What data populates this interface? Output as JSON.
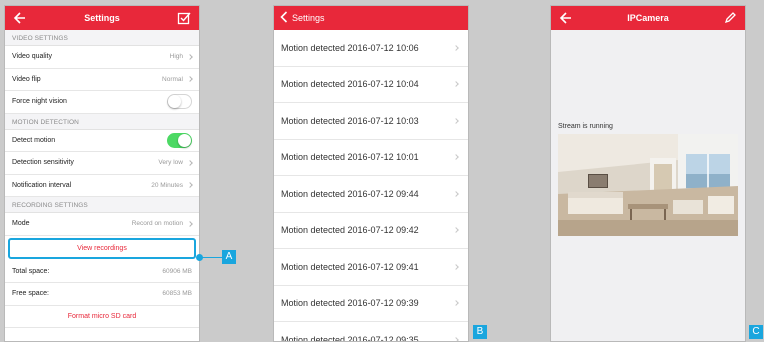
{
  "settings": {
    "title": "Settings",
    "sections": [
      {
        "header": "VIDEO SETTINGS",
        "rows": [
          {
            "label": "Video quality",
            "value": "High",
            "kind": "chevron"
          },
          {
            "label": "Video flip",
            "value": "Normal",
            "kind": "chevron"
          },
          {
            "label": "Force night vision",
            "kind": "toggle",
            "on": false
          }
        ]
      },
      {
        "header": "MOTION DETECTION",
        "rows": [
          {
            "label": "Detect motion",
            "kind": "toggle",
            "on": true
          },
          {
            "label": "Detection sensitivity",
            "value": "Very low",
            "kind": "chevron"
          },
          {
            "label": "Notification interval",
            "value": "20 Minutes",
            "kind": "chevron"
          }
        ]
      },
      {
        "header": "RECORDING SETTINGS",
        "rows": [
          {
            "label": "Mode",
            "value": "Record on motion",
            "kind": "chevron"
          }
        ]
      }
    ],
    "view_recordings": "View recordings",
    "total_space_label": "Total space:",
    "total_space_value": "60906 MB",
    "free_space_label": "Free space:",
    "free_space_value": "60853 MB",
    "format_label": "Format micro SD card"
  },
  "recordings": {
    "back_label": "Settings",
    "items": [
      "Motion detected 2016-07-12 10:06",
      "Motion detected 2016-07-12 10:04",
      "Motion detected 2016-07-12 10:03",
      "Motion detected 2016-07-12 10:01",
      "Motion detected 2016-07-12 09:44",
      "Motion detected 2016-07-12 09:42",
      "Motion detected 2016-07-12 09:41",
      "Motion detected 2016-07-12 09:39",
      "Motion detected 2016-07-12 09:35"
    ]
  },
  "camera": {
    "title": "IPCamera",
    "stream_status": "Stream is running"
  },
  "callouts": {
    "a": "A",
    "b": "B",
    "c": "C"
  },
  "colors": {
    "accent": "#e8283a",
    "callout": "#1aa6de",
    "toggle_on": "#4cd964"
  },
  "icons": {
    "back": "back-arrow-icon",
    "confirm": "checkbox-icon",
    "edit": "pencil-icon",
    "chevron": "chevron-right-icon"
  }
}
